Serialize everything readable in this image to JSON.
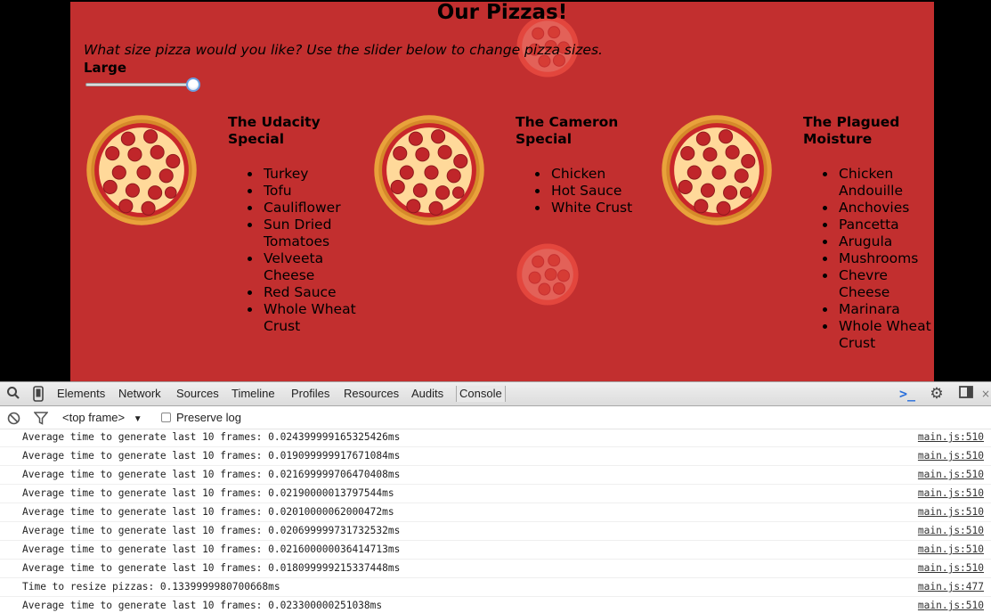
{
  "page": {
    "title": "Our Pizzas!",
    "prompt": "What size pizza would you like? Use the slider below to change pizza sizes.",
    "size_label": "Large",
    "slider_value": 1.0,
    "pizzas": [
      {
        "name": "The Udacity Special",
        "toppings": [
          "Turkey",
          "Tofu",
          "Cauliflower",
          "Sun Dried Tomatoes",
          "Velveeta Cheese",
          "Red Sauce",
          "Whole Wheat Crust"
        ]
      },
      {
        "name": "The Cameron Special",
        "toppings": [
          "Chicken",
          "Hot Sauce",
          "White Crust"
        ]
      },
      {
        "name": "The Plagued Moisture",
        "toppings": [
          "Chicken Andouille",
          "Anchovies",
          "Pancetta",
          "Arugula",
          "Mushrooms",
          "Chevre Cheese",
          "Marinara",
          "Whole Wheat Crust"
        ]
      }
    ]
  },
  "devtools": {
    "tabs": [
      "Elements",
      "Network",
      "Sources",
      "Timeline",
      "Profiles",
      "Resources",
      "Audits",
      "Console"
    ],
    "active_tab": "Console",
    "frame_select": "<top frame>",
    "preserve_log_label": "Preserve log",
    "preserve_log_checked": false,
    "console_rows": [
      {
        "msg": "Average time to generate last 10 frames: 0.024399999165325426ms",
        "src": "main.js:510"
      },
      {
        "msg": "Average time to generate last 10 frames: 0.019099999917671084ms",
        "src": "main.js:510"
      },
      {
        "msg": "Average time to generate last 10 frames: 0.021699999706470408ms",
        "src": "main.js:510"
      },
      {
        "msg": "Average time to generate last 10 frames: 0.02190000013797544ms",
        "src": "main.js:510"
      },
      {
        "msg": "Average time to generate last 10 frames: 0.02010000062000472ms",
        "src": "main.js:510"
      },
      {
        "msg": "Average time to generate last 10 frames: 0.020699999731732532ms",
        "src": "main.js:510"
      },
      {
        "msg": "Average time to generate last 10 frames: 0.021600000036414713ms",
        "src": "main.js:510"
      },
      {
        "msg": "Average time to generate last 10 frames: 0.018099999215337448ms",
        "src": "main.js:510"
      },
      {
        "msg": "Time to resize pizzas: 0.1339999980700668ms",
        "src": "main.js:477"
      },
      {
        "msg": "Average time to generate last 10 frames: 0.023300000251038ms",
        "src": "main.js:510"
      }
    ]
  },
  "colors": {
    "page_bg": "#c22f2f",
    "letterbox": "#000000",
    "devtools_bg": "#ffffff",
    "slider_thumb_border": "#6a9fe0"
  }
}
